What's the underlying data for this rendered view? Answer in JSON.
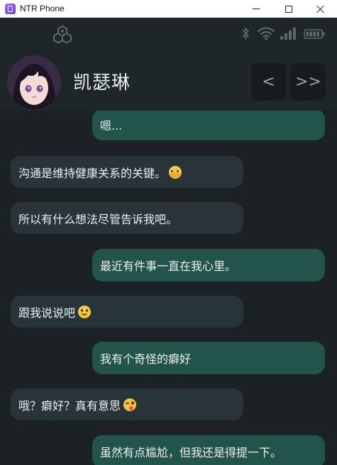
{
  "window": {
    "title": "NTR Phone"
  },
  "statusbar": {
    "icons": [
      "hex-network-icon",
      "bluetooth-icon",
      "wifi-icon",
      "signal-icon",
      "battery-icon"
    ]
  },
  "header": {
    "contact_name": "凯瑟琳",
    "prev_label": "<",
    "next_label": ">>"
  },
  "messages": [
    {
      "side": "sent",
      "text": "嗯..."
    },
    {
      "side": "recv",
      "text": "沟通是维持健康关系的关键。",
      "emoji": "hugging-face-emoji"
    },
    {
      "side": "recv",
      "text": "所以有什么想法尽管告诉我吧。"
    },
    {
      "side": "sent",
      "text": "最近有件事一直在我心里。"
    },
    {
      "side": "recv",
      "text": "跟我说说吧",
      "emoji": "smiling-face-emoji"
    },
    {
      "side": "sent",
      "text": "我有个奇怪的癖好"
    },
    {
      "side": "recv",
      "text": "哦？癖好？真有意思",
      "emoji": "winking-tongue-emoji"
    },
    {
      "side": "sent",
      "text": "虽然有点尴尬，但我还是得提一下。"
    }
  ],
  "colors": {
    "background": "#1b2124",
    "header": "#1e2629",
    "sent_bubble": "#22544b",
    "received_bubble": "#29333a",
    "text": "#ecf1f1"
  }
}
